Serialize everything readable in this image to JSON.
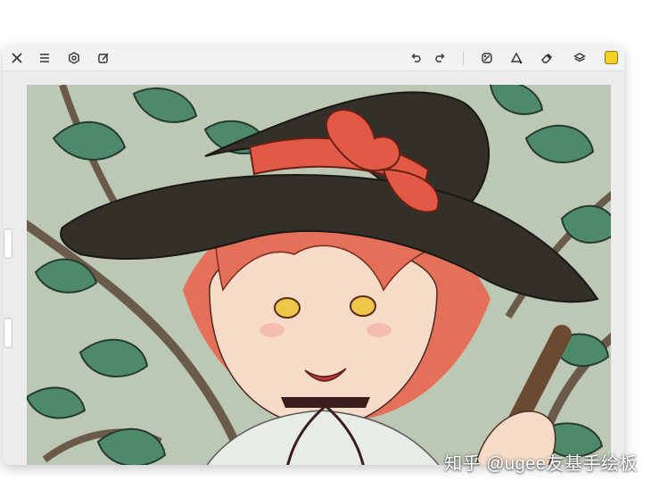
{
  "toolbar": {
    "left_icons": [
      "close-icon",
      "menu-icon",
      "settings-icon",
      "edit-image-icon"
    ],
    "right_icons": [
      "undo-icon",
      "redo-icon",
      "brush-tool-icon",
      "shape-tool-icon",
      "eraser-icon",
      "layers-icon"
    ],
    "current_color": "#f2d024"
  },
  "watermark": {
    "text": "知乎 @ugee友基手绘板"
  },
  "colors": {
    "canvas_bg": "#bcc7b4",
    "leaf": "#4e8a6a",
    "hat": "#2f2b24",
    "bow": "#e05a45",
    "hair": "#e4705a"
  }
}
